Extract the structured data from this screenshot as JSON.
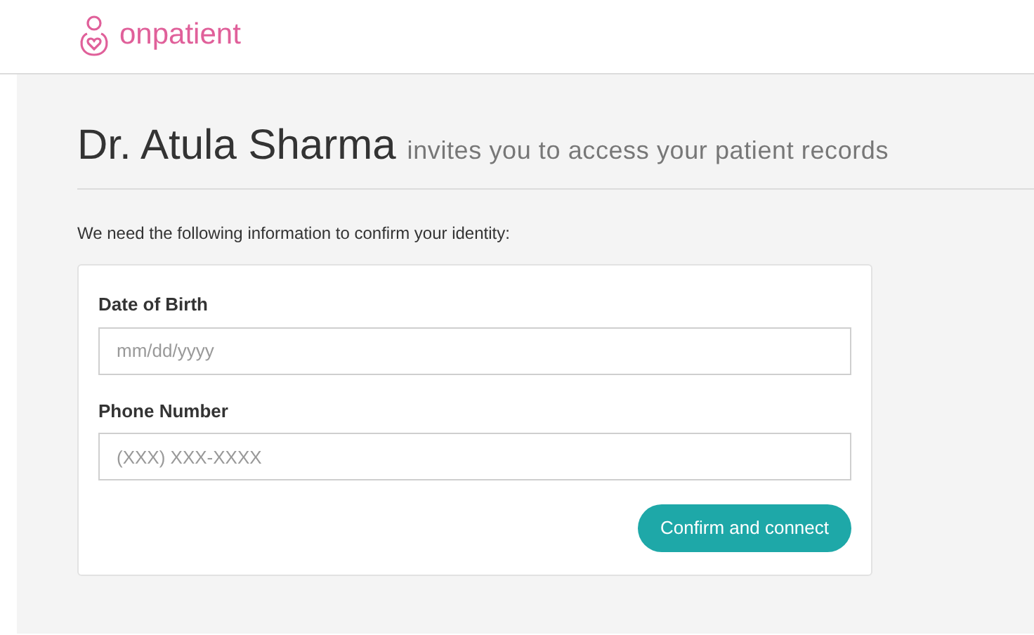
{
  "header": {
    "brand": "onpatient"
  },
  "heading": {
    "name": "Dr. Atula Sharma",
    "rest": "invites you to access your patient records"
  },
  "intro": "We need the following information to confirm your identity:",
  "form": {
    "fields": [
      {
        "label": "Date of Birth",
        "placeholder": "mm/dd/yyyy"
      },
      {
        "label": "Phone Number",
        "placeholder": "(XXX) XXX-XXXX"
      }
    ],
    "button": "Confirm and connect"
  }
}
